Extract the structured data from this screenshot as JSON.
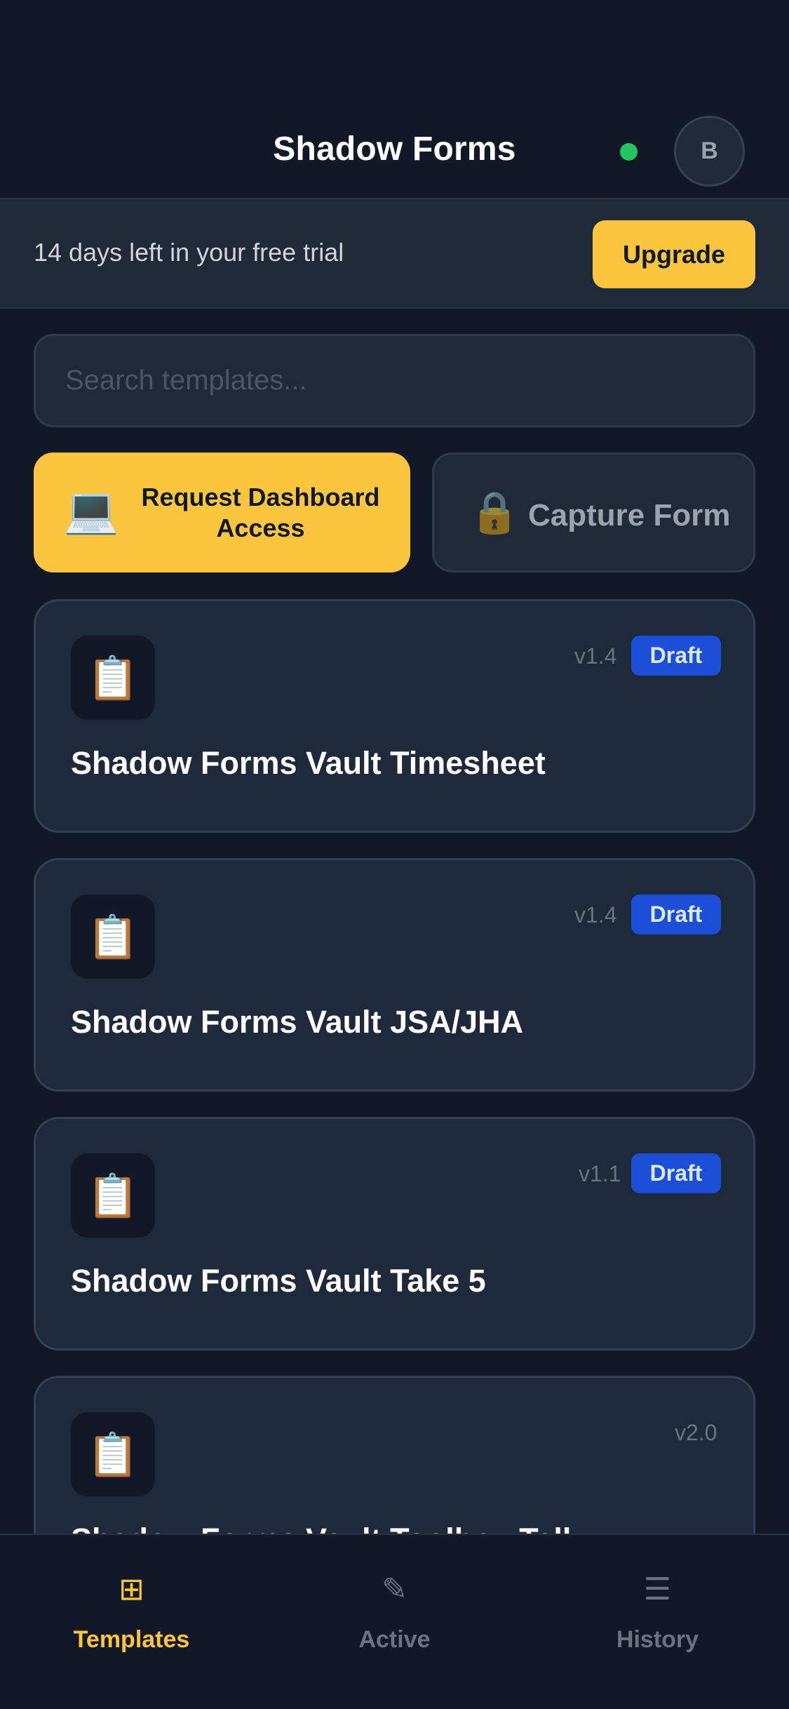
{
  "header": {
    "title": "Shadow Forms",
    "status_color": "#22c55e",
    "avatar_initial": "B"
  },
  "trial": {
    "message": "14 days left in your free trial",
    "upgrade_label": "Upgrade"
  },
  "search": {
    "placeholder": "Search templates...",
    "value": ""
  },
  "actions": {
    "request": {
      "icon": "laptop-icon",
      "emoji": "💻",
      "label": "Request Dashboard Access"
    },
    "capture": {
      "icon": "lock-icon",
      "emoji": "🔒",
      "label": "Capture Form"
    }
  },
  "templates": [
    {
      "name": "Shadow Forms Vault Timesheet",
      "version": "v1.4",
      "status": "Draft",
      "icon": "clipboard-icon",
      "emoji": "📋"
    },
    {
      "name": "Shadow Forms Vault JSA/JHA",
      "version": "v1.4",
      "status": "Draft",
      "icon": "clipboard-icon",
      "emoji": "📋"
    },
    {
      "name": "Shadow Forms Vault Take 5",
      "version": "v1.1",
      "status": "Draft",
      "icon": "clipboard-icon",
      "emoji": "📋"
    },
    {
      "name": "Shadow Forms Vault Toolbox Talk",
      "version": "v2.0",
      "status": "",
      "icon": "clipboard-icon",
      "emoji": "📋"
    }
  ],
  "nav": {
    "templates": {
      "label": "Templates",
      "icon": "grid-icon",
      "glyph": "⊞"
    },
    "active": {
      "label": "Active",
      "icon": "pencil-icon",
      "glyph": "✎"
    },
    "history": {
      "label": "History",
      "icon": "list-icon",
      "glyph": "☰"
    }
  },
  "colors": {
    "accent": "#fcc540",
    "background": "#111827",
    "card": "#1e293b",
    "draft_badge": "#1d4ed8"
  }
}
